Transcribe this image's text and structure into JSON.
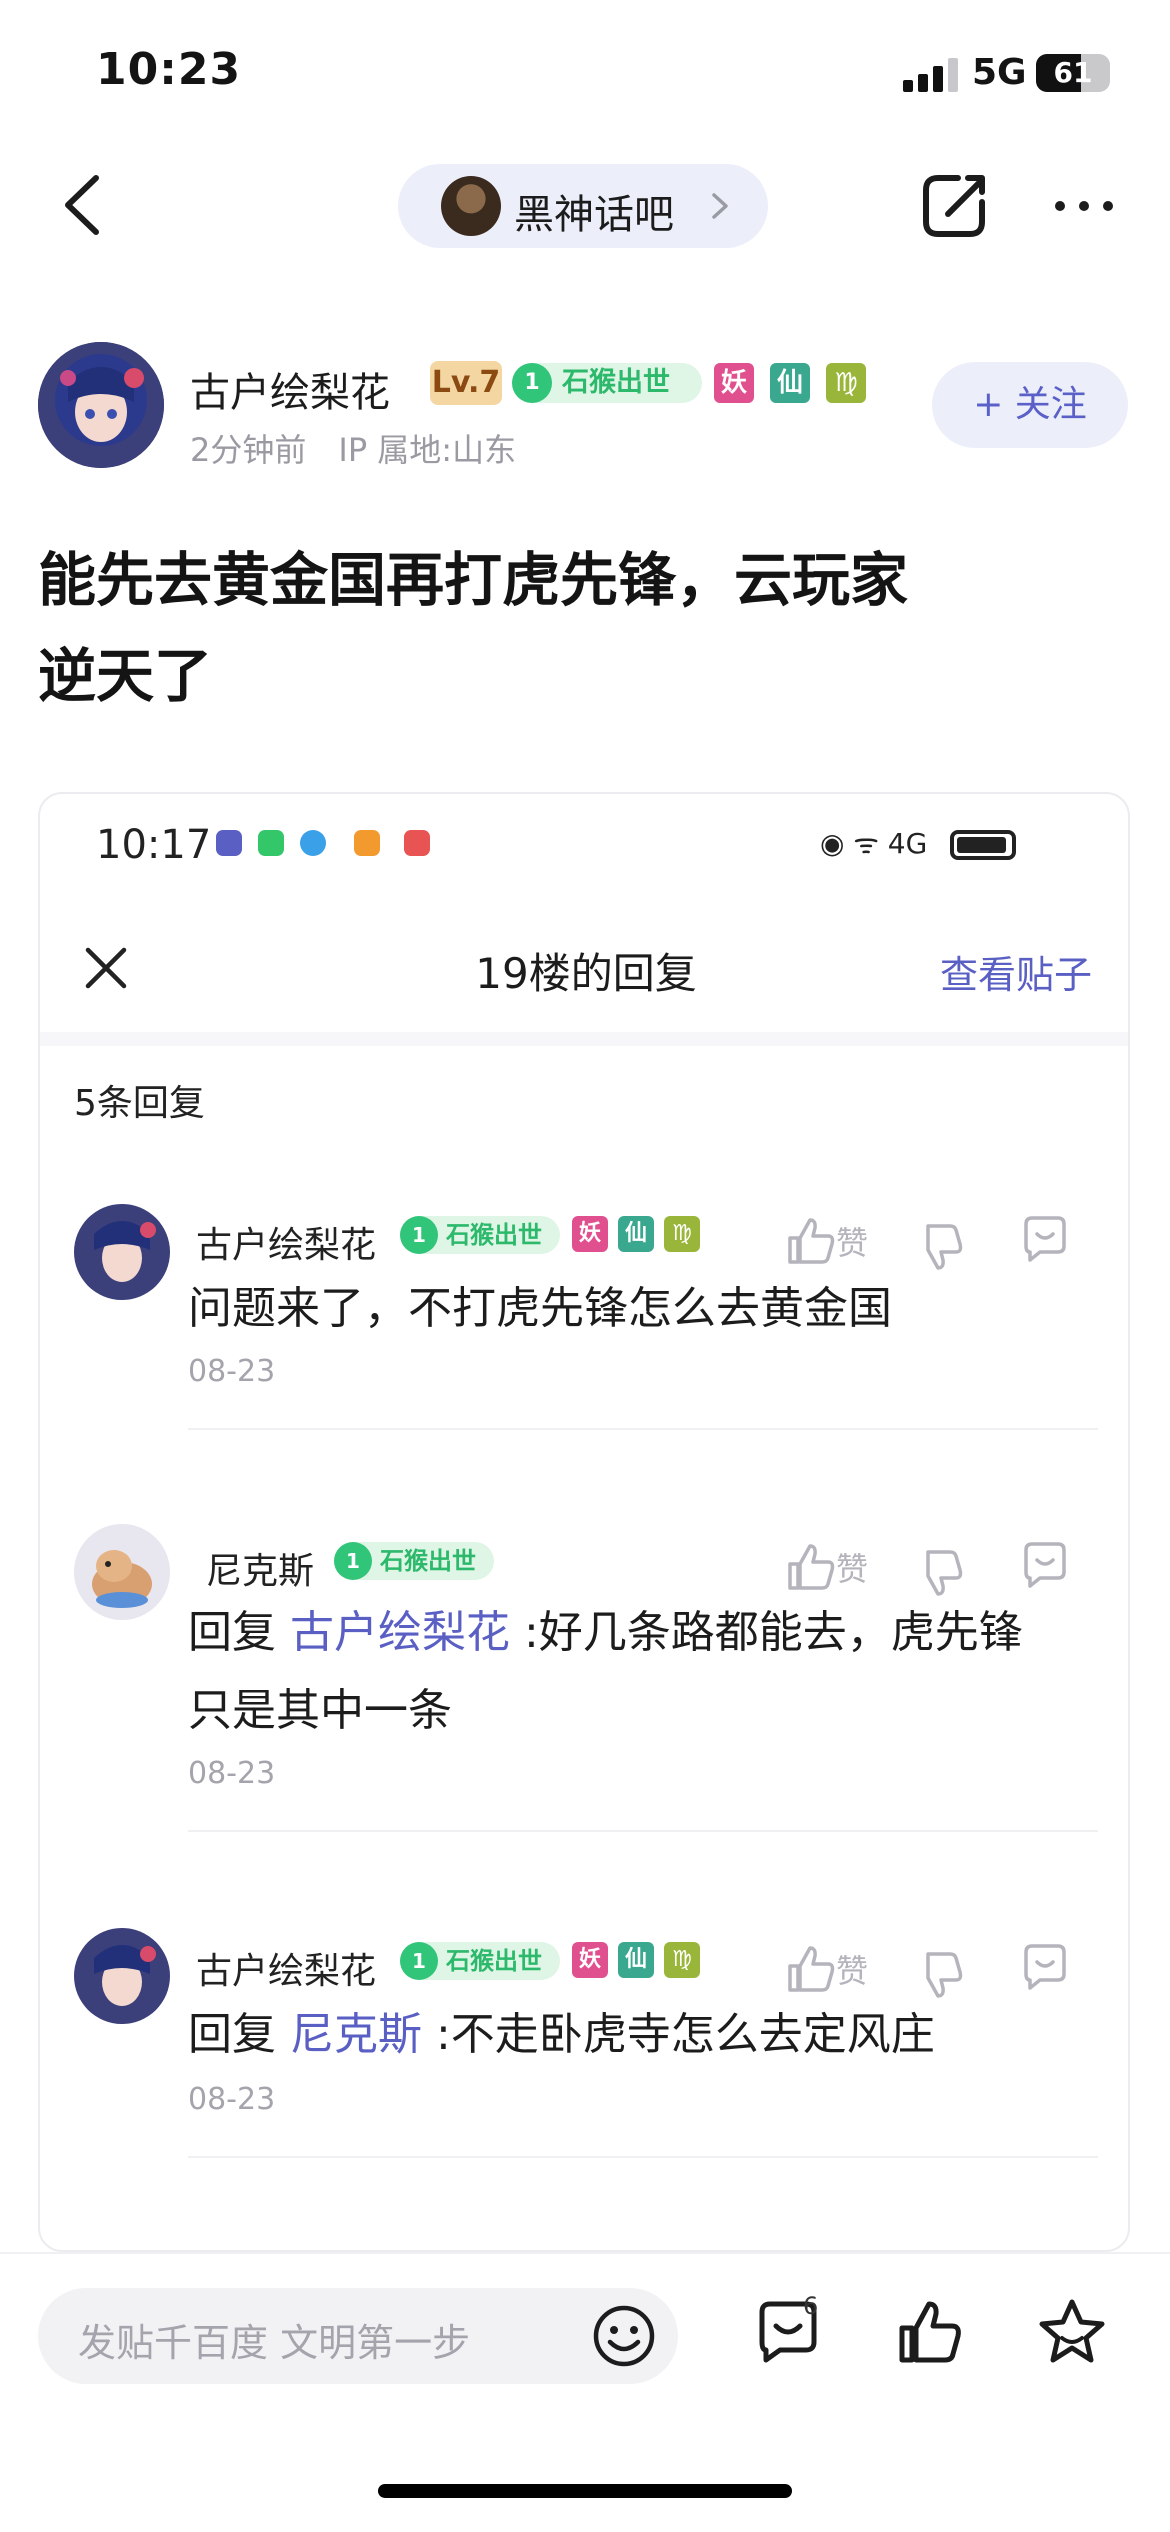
{
  "status_bar": {
    "time": "10:23",
    "network": "5G",
    "battery": "61"
  },
  "nav": {
    "forum_name": "黑神话吧"
  },
  "author": {
    "name": "古户绘梨花",
    "level": "Lv.7",
    "title_badge": "石猴出世",
    "title_level": "1",
    "tags": [
      "妖",
      "仙",
      "♍"
    ],
    "time": "2分钟前",
    "ip": "IP 属地:山东",
    "follow_label": "+ 关注"
  },
  "post": {
    "title_line1": "能先去黄金国再打虎先锋，云玩家",
    "title_line2": "逆天了"
  },
  "screenshot": {
    "time": "10:17",
    "status_right": "◉ ᯤ 4G",
    "title": "19楼的回复",
    "view_post": "查看贴子",
    "reply_count": "5条回复",
    "comments": [
      {
        "name": "古户绘梨花",
        "badge": "石猴出世",
        "badge_level": "1",
        "tags": [
          "妖",
          "仙",
          "♍"
        ],
        "prefix": "",
        "mention": "",
        "text": "问题来了，不打虎先锋怎么去黄金国",
        "text2": "",
        "date": "08-23",
        "zan": "赞"
      },
      {
        "name": "尼克斯",
        "badge": "石猴出世",
        "badge_level": "1",
        "tags": [],
        "prefix": "回复 ",
        "mention": "古户绘梨花",
        "text": " :好几条路都能去，虎先锋",
        "text2": "只是其中一条",
        "date": "08-23",
        "zan": "赞"
      },
      {
        "name": "古户绘梨花",
        "badge": "石猴出世",
        "badge_level": "1",
        "tags": [
          "妖",
          "仙",
          "♍"
        ],
        "prefix": "回复 ",
        "mention": "尼克斯",
        "text": " :不走卧虎寺怎么去定风庄",
        "text2": "",
        "date": "08-23",
        "zan": "赞"
      }
    ]
  },
  "bottom_bar": {
    "placeholder": "发贴千百度 文明第一步",
    "comment_count": "6"
  },
  "colors": {
    "accent": "#5a5fc4",
    "badge_green": "#2db96b",
    "tag_pink": "#e0508f",
    "tag_teal": "#3aa88e",
    "tag_olive": "#9ab63a"
  }
}
